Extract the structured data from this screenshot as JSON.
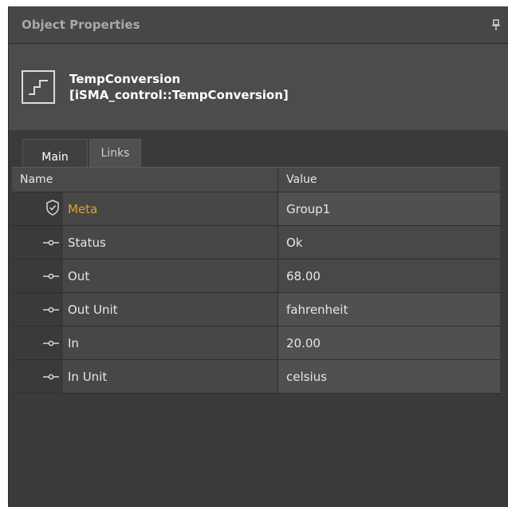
{
  "panel": {
    "title": "Object Properties"
  },
  "object": {
    "name": "TempConversion",
    "type": "[iSMA_control::TempConversion]"
  },
  "tabs": [
    {
      "label": "Main",
      "active": true
    },
    {
      "label": "Links",
      "active": false
    }
  ],
  "grid": {
    "headers": {
      "name": "Name",
      "value": "Value"
    },
    "rows": [
      {
        "icon": "shield-icon",
        "name": "Meta",
        "value": "Group1"
      },
      {
        "icon": "slot-icon",
        "name": "Status",
        "value": "Ok"
      },
      {
        "icon": "slot-icon",
        "name": "Out",
        "value": "68.00"
      },
      {
        "icon": "slot-icon",
        "name": "Out Unit",
        "value": "fahrenheit"
      },
      {
        "icon": "slot-icon",
        "name": "In",
        "value": "20.00"
      },
      {
        "icon": "slot-icon",
        "name": "In Unit",
        "value": "celsius"
      }
    ]
  },
  "colors": {
    "meta_label": "#e0a32d",
    "panel_bg": "#3a3a3a",
    "header_bg": "#4c4c4c"
  }
}
